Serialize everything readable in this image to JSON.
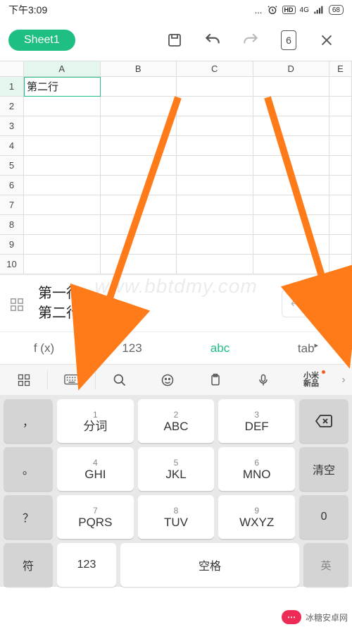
{
  "status": {
    "time": "下午3:09",
    "network": "4G",
    "battery": "68"
  },
  "toolbar": {
    "sheet_name": "Sheet1",
    "page_count": "6"
  },
  "grid": {
    "column_headers": [
      "A",
      "B",
      "C",
      "D",
      "E"
    ],
    "rows": [
      "1",
      "2",
      "3",
      "4",
      "5",
      "6",
      "7",
      "8",
      "9",
      "10"
    ],
    "selected_cell_value": "第二行"
  },
  "editor": {
    "line1": "第一行",
    "line2": "第二行"
  },
  "mode_tabs": {
    "fx": "f (x)",
    "num": "123",
    "abc": "abc",
    "tab": "tab"
  },
  "kb_toolbar": {
    "brand_top": "小米",
    "brand_bot": "新品"
  },
  "keys": {
    "r1": [
      {
        "n": "1",
        "l": "分词"
      },
      {
        "n": "2",
        "l": "ABC"
      },
      {
        "n": "3",
        "l": "DEF"
      }
    ],
    "r2": [
      {
        "n": "4",
        "l": "GHI"
      },
      {
        "n": "5",
        "l": "JKL"
      },
      {
        "n": "6",
        "l": "MNO"
      }
    ],
    "r3": [
      {
        "n": "7",
        "l": "PQRS"
      },
      {
        "n": "8",
        "l": "TUV"
      },
      {
        "n": "9",
        "l": "WXYZ"
      }
    ],
    "side": {
      "backspace_aria": "删除",
      "clear": "清空",
      "zero": "0"
    },
    "bottom": {
      "sym": "符",
      "num": "123",
      "space": "空格",
      "lang": "英"
    }
  },
  "punct": {
    "comma": "，",
    "period": "。",
    "question": "？"
  },
  "footer": {
    "brand": "冰糖安卓网"
  },
  "watermark": "www.bbtdmy.com"
}
